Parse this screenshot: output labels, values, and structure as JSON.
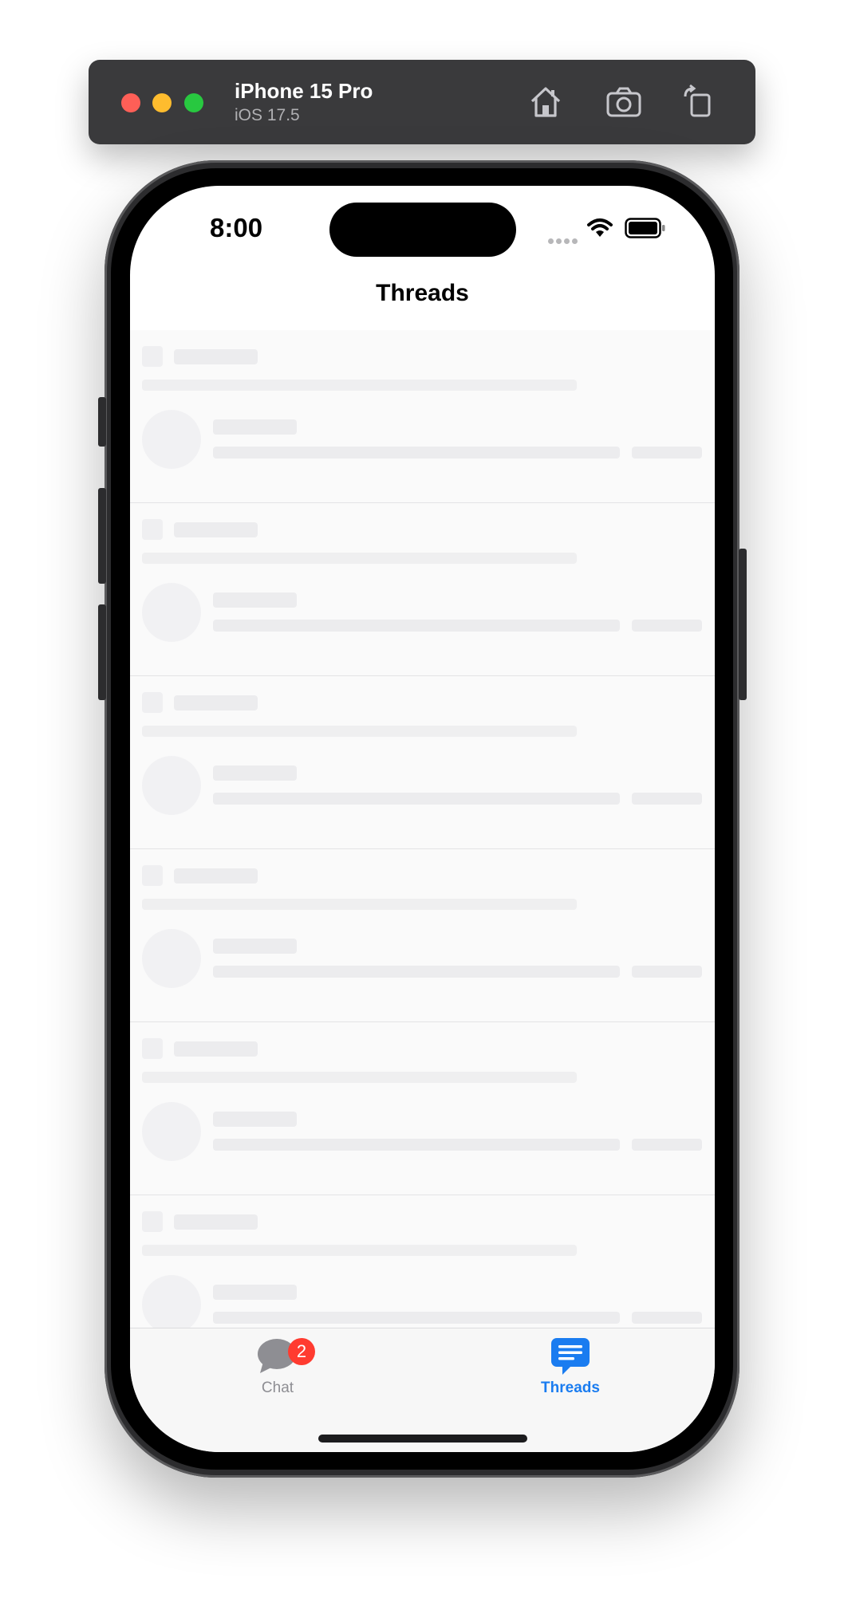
{
  "simulator": {
    "device_name": "iPhone 15 Pro",
    "os_version": "iOS 17.5",
    "toolbar_icons": [
      "home-icon",
      "screenshot-icon",
      "rotate-icon"
    ]
  },
  "status_bar": {
    "time": "8:00"
  },
  "nav": {
    "title": "Threads"
  },
  "list": {
    "state": "loading-skeleton",
    "rows": [
      1,
      2,
      3,
      4,
      5,
      6
    ]
  },
  "tabbar": {
    "tabs": [
      {
        "label": "Chat",
        "icon": "chat-bubble-icon",
        "badge": "2",
        "selected": false
      },
      {
        "label": "Threads",
        "icon": "threads-icon",
        "selected": true
      }
    ]
  },
  "colors": {
    "accent": "#1a7cf0",
    "badge": "#ff3b30",
    "inactive": "#8e8e93"
  }
}
